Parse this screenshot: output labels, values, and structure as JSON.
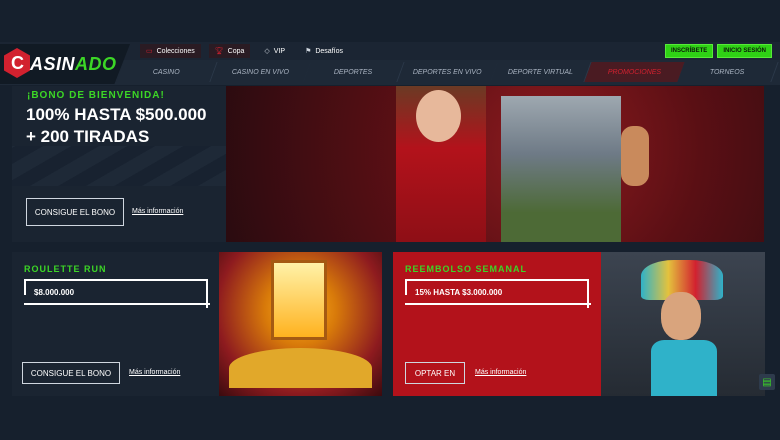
{
  "brand": {
    "logo_letter": "C",
    "name_part1": "ASIN",
    "name_part2": "ADO"
  },
  "subnav": [
    {
      "label": "Colecciones",
      "icon": "collections-icon"
    },
    {
      "label": "Copa",
      "icon": "trophy-icon"
    },
    {
      "label": "VIP",
      "icon": "diamond-icon"
    },
    {
      "label": "Desafíos",
      "icon": "flag-icon"
    }
  ],
  "auth": {
    "register": "INSCRÍBETE",
    "login": "INICIO SESIÓN"
  },
  "mainnav": [
    "CASINO",
    "CASINO EN VIVO",
    "DEPORTES",
    "DEPORTES EN VIVO",
    "DEPORTE VIRTUAL",
    "PROMOCIONES",
    "TORNEOS"
  ],
  "hero": {
    "kicker": "¡BONO DE BIENVENIDA!",
    "title_line1": "100% HASTA $500.000",
    "title_line2": "+ 200 TIRADAS",
    "cta": "CONSIGUE EL BONO",
    "more": "Más información"
  },
  "card1": {
    "title": "ROULETTE RUN",
    "amount": "$8.000.000",
    "cta": "CONSIGUE EL BONO",
    "more": "Más información"
  },
  "card2": {
    "title": "REEMBOLSO SEMANAL",
    "amount": "15% HASTA $3.000.000",
    "cta": "OPTAR EN",
    "more": "Más información"
  },
  "colors": {
    "accent_green": "#3cd626",
    "brand_red": "#d2212f",
    "bg": "#16202d"
  }
}
